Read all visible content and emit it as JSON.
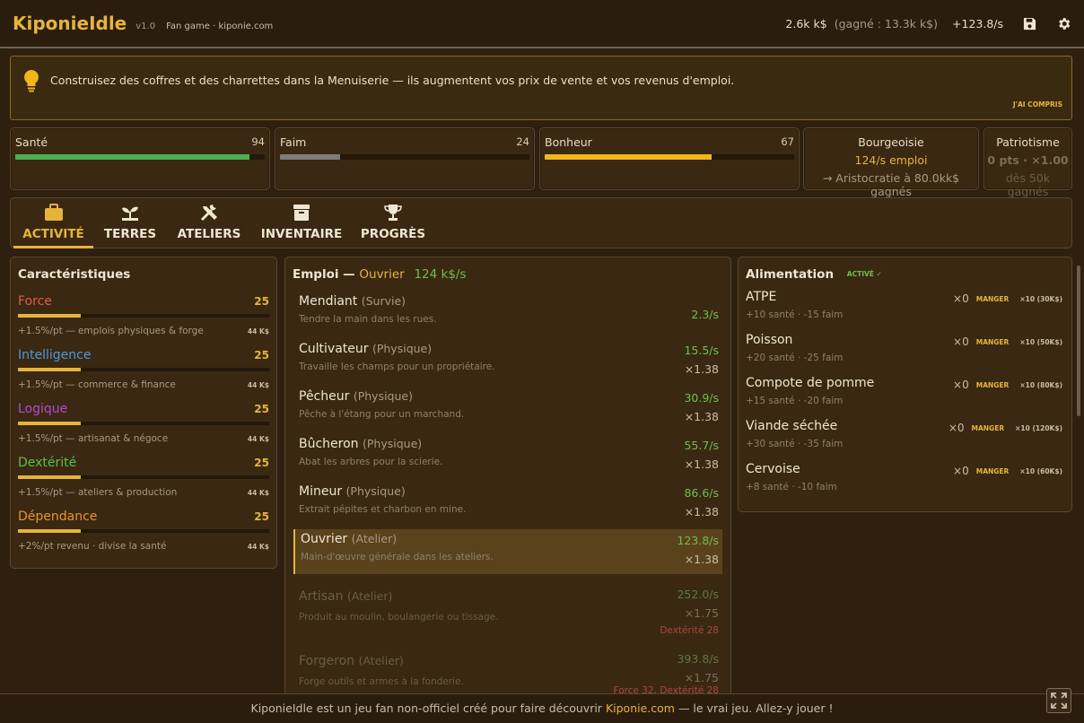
{
  "app": {
    "title": "KiponieIdle",
    "version": "v1.0",
    "tagline": "Fan game · kiponie.com"
  },
  "topbar": {
    "money": "2.6k k$",
    "earned": "(gagné : 13.3k k$)",
    "rate": "+123.8/s"
  },
  "banner": {
    "message": "Construisez des coffres et des charrettes dans la Menuiserie — ils augmentent vos prix de vente et vos revenus d'emploi.",
    "dismiss": "J'AI COMPRIS"
  },
  "stats": {
    "sante": {
      "label": "Santé",
      "value": "94",
      "level": 0.94,
      "color": "#4caf50"
    },
    "faim": {
      "label": "Faim",
      "value": "24",
      "level": 0.24,
      "color": "#7c7c7c"
    },
    "bonheur": {
      "label": "Bonheur",
      "value": "67",
      "level": 0.67,
      "color": "#f2b61c"
    },
    "bourgeoisie": {
      "title": "Bourgeoisie",
      "line2": "124/s emploi",
      "line3": "→ Aristocratie à 80.0kk$ gagnés"
    },
    "patriotisme": {
      "title": "Patriotisme",
      "line2": "0 pts · ×1.00",
      "line3": "dès 50k gagnés"
    }
  },
  "tabs": [
    {
      "label": "ACTIVITÉ",
      "icon": "briefcase-icon"
    },
    {
      "label": "TERRES",
      "icon": "sprout-icon"
    },
    {
      "label": "ATELIERS",
      "icon": "tools-icon"
    },
    {
      "label": "INVENTAIRE",
      "icon": "archive-icon"
    },
    {
      "label": "PROGRÈS",
      "icon": "trophy-icon"
    }
  ],
  "caracteristiques": {
    "title": "Caractéristiques",
    "items": [
      {
        "name": "Force",
        "value": "25",
        "desc": "+1.5%/pt — emplois physiques & forge",
        "cost": "44 K$",
        "color": "#e05a4a",
        "level": 0.25
      },
      {
        "name": "Intelligence",
        "value": "25",
        "desc": "+1.5%/pt — commerce & finance",
        "cost": "44 K$",
        "color": "#4a9ae0",
        "level": 0.25
      },
      {
        "name": "Logique",
        "value": "25",
        "desc": "+1.5%/pt — artisanat & négoce",
        "cost": "44 K$",
        "color": "#b44ad0",
        "level": 0.25
      },
      {
        "name": "Dextérité",
        "value": "25",
        "desc": "+1.5%/pt — ateliers & production",
        "cost": "44 K$",
        "color": "#5ac04a",
        "level": 0.25
      },
      {
        "name": "Dépendance",
        "value": "25",
        "desc": "+2%/pt revenu · divise la santé",
        "cost": "44 K$",
        "color": "#e6962a",
        "level": 0.25
      }
    ]
  },
  "emploi": {
    "title_prefix": "Emploi —",
    "current_job": "Ouvrier",
    "current_rate": "124 k$/s",
    "jobs": [
      {
        "name": "Mendiant",
        "category": "(Survie)",
        "desc": "Tendre la main dans les rues.",
        "rate": "2.3/s",
        "mult": "",
        "req": ""
      },
      {
        "name": "Cultivateur",
        "category": "(Physique)",
        "desc": "Travaille les champs pour un propriétaire.",
        "rate": "15.5/s",
        "mult": "×1.38",
        "req": ""
      },
      {
        "name": "Pêcheur",
        "category": "(Physique)",
        "desc": "Pêche à l'étang pour un marchand.",
        "rate": "30.9/s",
        "mult": "×1.38",
        "req": ""
      },
      {
        "name": "Bûcheron",
        "category": "(Physique)",
        "desc": "Abat les arbres pour la scierie.",
        "rate": "55.7/s",
        "mult": "×1.38",
        "req": ""
      },
      {
        "name": "Mineur",
        "category": "(Physique)",
        "desc": "Extrait pépites et charbon en mine.",
        "rate": "86.6/s",
        "mult": "×1.38",
        "req": ""
      },
      {
        "name": "Ouvrier",
        "category": "(Atelier)",
        "desc": "Main-d'œuvre générale dans les ateliers.",
        "rate": "123.8/s",
        "mult": "×1.38",
        "req": ""
      },
      {
        "name": "Artisan",
        "category": "(Atelier)",
        "desc": "Produit au moulin, boulangerie ou tissage.",
        "rate": "252.0/s",
        "mult": "×1.75",
        "req": "Dextérité 28"
      },
      {
        "name": "Forgeron",
        "category": "(Atelier)",
        "desc": "Forge outils et armes à la fonderie.",
        "rate": "393.8/s",
        "mult": "×1.75",
        "req": "Force 32, Dextérité 28"
      }
    ]
  },
  "alimentation": {
    "title": "Alimentation",
    "badge": "ACTIVÉ ✓",
    "items": [
      {
        "name": "ATPE",
        "effect": "+10 santé · -15 faim",
        "qty": "×0",
        "eat": "MANGER",
        "buy": "×10 (30K$)"
      },
      {
        "name": "Poisson",
        "effect": "+20 santé · -25 faim",
        "qty": "×0",
        "eat": "MANGER",
        "buy": "×10 (50K$)"
      },
      {
        "name": "Compote de pomme",
        "effect": "+15 santé · -20 faim",
        "qty": "×0",
        "eat": "MANGER",
        "buy": "×10 (80K$)"
      },
      {
        "name": "Viande séchée",
        "effect": "+30 santé · -35 faim",
        "qty": "×0",
        "eat": "MANGER",
        "buy": "×10 (120K$)"
      },
      {
        "name": "Cervoise",
        "effect": "+8 santé · -10 faim",
        "qty": "×0",
        "eat": "MANGER",
        "buy": "×10 (60K$)"
      }
    ]
  },
  "footer": {
    "before": "KiponieIdle est un jeu fan non-officiel créé pour faire découvrir",
    "link": "Kiponie.com",
    "after": "— le vrai jeu. Allez-y jouer !"
  }
}
